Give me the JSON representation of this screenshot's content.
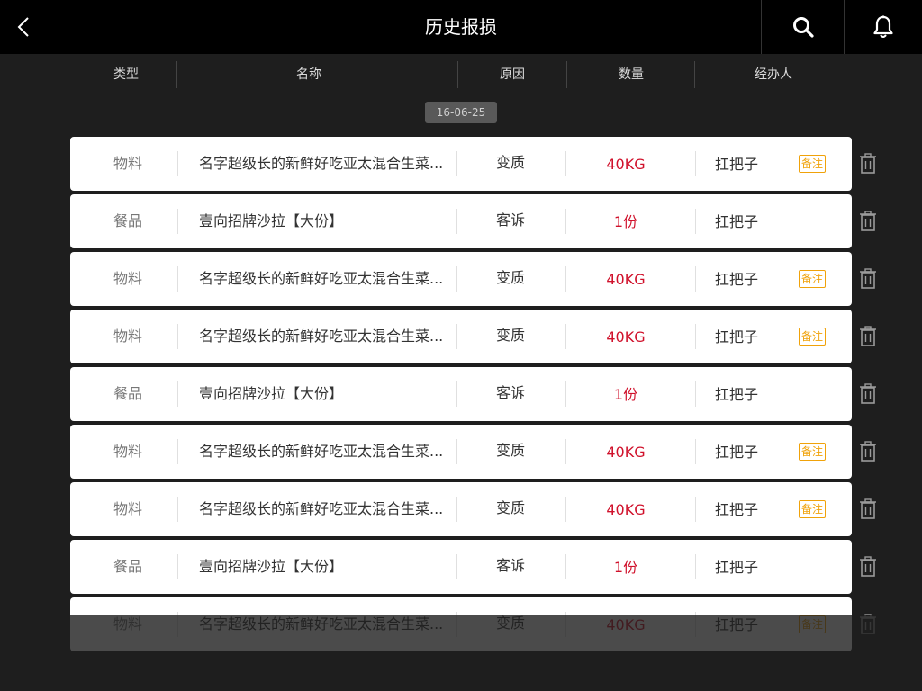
{
  "header": {
    "title": "历史报损"
  },
  "columns": {
    "type": "类型",
    "name": "名称",
    "reason": "原因",
    "qty": "数量",
    "person": "经办人"
  },
  "date_label": "16-06-25",
  "note_label": "备注",
  "rows": [
    {
      "type": "物料",
      "name": "名字超级长的新鲜好吃亚太混合生菜...",
      "reason": "变质",
      "qty": "40KG",
      "person": "扛把子",
      "note": true
    },
    {
      "type": "餐品",
      "name": "壹向招牌沙拉【大份】",
      "reason": "客诉",
      "qty": "1份",
      "person": "扛把子",
      "note": false
    },
    {
      "type": "物料",
      "name": "名字超级长的新鲜好吃亚太混合生菜...",
      "reason": "变质",
      "qty": "40KG",
      "person": "扛把子",
      "note": true
    },
    {
      "type": "物料",
      "name": "名字超级长的新鲜好吃亚太混合生菜...",
      "reason": "变质",
      "qty": "40KG",
      "person": "扛把子",
      "note": true
    },
    {
      "type": "餐品",
      "name": "壹向招牌沙拉【大份】",
      "reason": "客诉",
      "qty": "1份",
      "person": "扛把子",
      "note": false
    },
    {
      "type": "物料",
      "name": "名字超级长的新鲜好吃亚太混合生菜...",
      "reason": "变质",
      "qty": "40KG",
      "person": "扛把子",
      "note": true
    },
    {
      "type": "物料",
      "name": "名字超级长的新鲜好吃亚太混合生菜...",
      "reason": "变质",
      "qty": "40KG",
      "person": "扛把子",
      "note": true
    },
    {
      "type": "餐品",
      "name": "壹向招牌沙拉【大份】",
      "reason": "客诉",
      "qty": "1份",
      "person": "扛把子",
      "note": false
    },
    {
      "type": "物料",
      "name": "名字超级长的新鲜好吃亚太混合生菜...",
      "reason": "变质",
      "qty": "40KG",
      "person": "扛把子",
      "note": true
    }
  ],
  "colors": {
    "accent_red": "#d0112b",
    "note_orange": "#f0a20a",
    "background": "#1e1e1e",
    "topbar": "#000000"
  },
  "icons": [
    "back-arrow-icon",
    "search-icon",
    "bell-icon",
    "trash-icon"
  ]
}
